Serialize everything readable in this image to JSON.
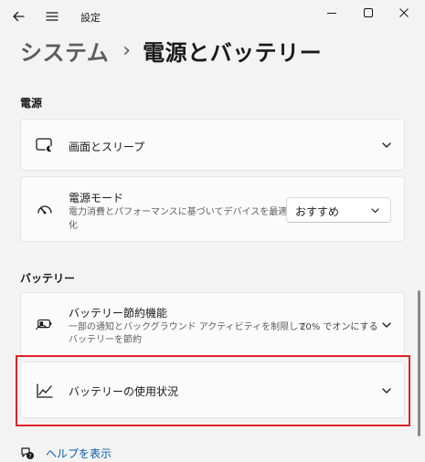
{
  "app": {
    "title": "設定"
  },
  "breadcrumb": {
    "parent": "システム",
    "separator": "›",
    "current": "電源とバッテリー"
  },
  "sections": {
    "power": "電源",
    "battery": "バッテリー"
  },
  "cards": {
    "screen_sleep": {
      "title": "画面とスリープ",
      "icon": "screen-sleep-icon"
    },
    "power_mode": {
      "title": "電源モード",
      "desc_line1": "電力消費とパフォーマンスに基づいてデバイスを最適",
      "desc_line2": "化",
      "selected": "おすすめ",
      "icon": "power-mode-icon"
    },
    "battery_saver": {
      "title": "バッテリー節約機能",
      "desc_line1": "一部の通知とバックグラウンド アクティビティを制限して",
      "desc_line2": "バッテリーを節約",
      "status": "20% でオンにする",
      "icon": "battery-saver-icon"
    },
    "battery_usage": {
      "title": "バッテリーの使用状況",
      "icon": "usage-chart-icon"
    }
  },
  "help": {
    "label": "ヘルプを表示"
  },
  "colors": {
    "highlight": "#e0202a",
    "link": "#0b5cad",
    "background": "#f3f3f3"
  }
}
